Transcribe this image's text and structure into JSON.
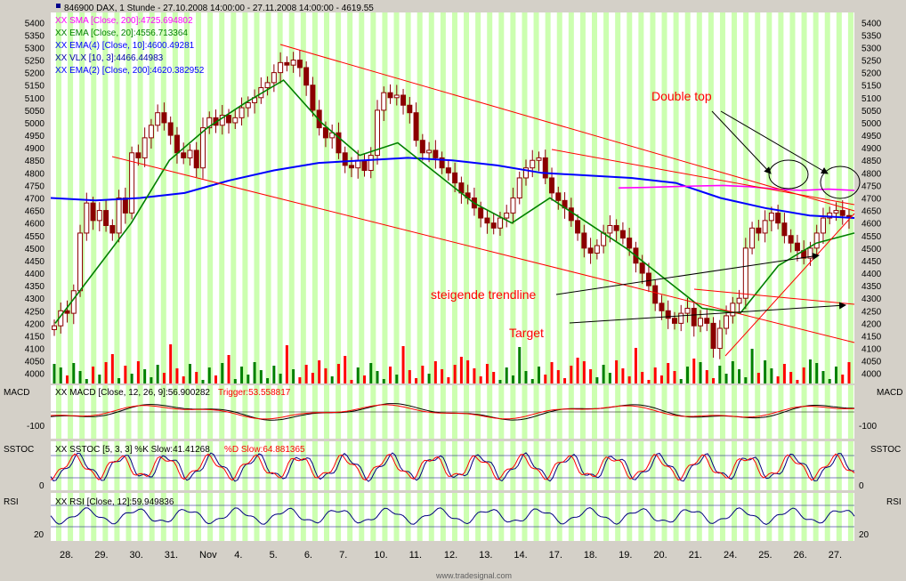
{
  "main_panel": {
    "header": "846900  DAX, 1 Stunde - 27.10.2008 14:00:00 - 27.11.2008 14:00:00 - 4619.55",
    "legend": [
      {
        "text": "XX SMA [Close, 200]:4725.694802",
        "color": "#ff00ff"
      },
      {
        "text": "XX EMA [Close, 20]:4556.713364",
        "color": "#008000"
      },
      {
        "text": "XX EMA(4) [Close, 10]:4600.49281",
        "color": "#0000ff"
      },
      {
        "text": "XX VLX [10, 3]:4466.44983",
        "color": "#0000aa"
      },
      {
        "text": "XX EMA(2) [Close, 200]:4620.382952",
        "color": "#0000ff"
      }
    ],
    "annotations": [
      {
        "text": "Double top",
        "color": "#ff0000"
      },
      {
        "text": "steigende trendline",
        "color": "#ff0000"
      },
      {
        "text": "Target",
        "color": "#ff0000"
      }
    ]
  },
  "macd_panel": {
    "label": "MACD",
    "legend_prefix": "XX MACD [Close, 12, 26, 9]:56.900282",
    "legend_trigger": "Trigger:53.558817",
    "ticks": [
      "-100"
    ]
  },
  "sstoc_panel": {
    "label": "SSTOC",
    "legend_prefix": "XX SSTOC [5, 3, 3] %K Slow:41.41268",
    "legend_d": "%D Slow:64.881365",
    "ticks": [
      "0"
    ]
  },
  "rsi_panel": {
    "label": "RSI",
    "legend": "XX RSI [Close, 12]:59.949836",
    "ticks": [
      "20"
    ]
  },
  "watermark": "www.tradesignal.com",
  "colors": {
    "background": "#ffffff",
    "stripe": "#ccffb0",
    "candle": "#8b0000",
    "volume_up": "#008000",
    "volume_down": "#ff0000",
    "trendline": "#ff0000",
    "arrow": "#000000"
  },
  "chart_data": {
    "type": "candlestick",
    "y_ticks": [
      4000,
      4050,
      4100,
      4150,
      4200,
      4250,
      4300,
      4350,
      4400,
      4450,
      4500,
      4550,
      4600,
      4650,
      4700,
      4750,
      4800,
      4850,
      4900,
      4950,
      5000,
      5050,
      5100,
      5150,
      5200,
      5250,
      5300,
      5350,
      5400
    ],
    "ylim": [
      3960,
      5440
    ],
    "x_labels": [
      "28.",
      "29.",
      "30.",
      "31.",
      "Nov",
      "4.",
      "5.",
      "6.",
      "7.",
      "10.",
      "11.",
      "12.",
      "13.",
      "14.",
      "17.",
      "18.",
      "19.",
      "20.",
      "21.",
      "24.",
      "25.",
      "26.",
      "27."
    ],
    "closes": [
      4190,
      4250,
      4240,
      4330,
      4560,
      4680,
      4610,
      4650,
      4590,
      4560,
      4700,
      4640,
      4880,
      4860,
      4940,
      4990,
      5040,
      5000,
      4950,
      4880,
      4860,
      4890,
      4820,
      4980,
      5020,
      4990,
      5030,
      5000,
      5020,
      5060,
      5080,
      5100,
      5140,
      5160,
      5200,
      5240,
      5230,
      5250,
      5220,
      5150,
      5050,
      4980,
      4940,
      4960,
      4880,
      4830,
      4820,
      4850,
      4810,
      4870,
      5050,
      5120,
      5100,
      5110,
      5070,
      5040,
      4930,
      4880,
      4890,
      4860,
      4820,
      4800,
      4760,
      4720,
      4700,
      4660,
      4620,
      4600,
      4580,
      4620,
      4640,
      4700,
      4780,
      4820,
      4850,
      4860,
      4780,
      4720,
      4690,
      4660,
      4610,
      4560,
      4500,
      4480,
      4510,
      4560,
      4590,
      4570,
      4540,
      4500,
      4440,
      4400,
      4350,
      4280,
      4250,
      4220,
      4200,
      4240,
      4260,
      4190,
      4220,
      4200,
      4100,
      4180,
      4230,
      4280,
      4300,
      4500,
      4580,
      4560,
      4610,
      4640,
      4600,
      4550,
      4520,
      4490,
      4460,
      4500,
      4560,
      4620,
      4640,
      4650,
      4630,
      4620
    ],
    "sma200": [
      4740,
      4742,
      4745,
      4748,
      4750,
      4745,
      4735,
      4730,
      4735,
      4730
    ],
    "ema20_sample": [
      4200,
      4400,
      4600,
      4850,
      4980,
      5080,
      5170,
      5000,
      4870,
      4920,
      4800,
      4680,
      4600,
      4700,
      4600,
      4500,
      4380,
      4260,
      4240,
      4430,
      4520,
      4560
    ],
    "ema200_sample": [
      4700,
      4690,
      4700,
      4720,
      4770,
      4810,
      4840,
      4850,
      4860,
      4850,
      4830,
      4800,
      4790,
      4780,
      4760,
      4700,
      4660,
      4630,
      4620
    ]
  }
}
